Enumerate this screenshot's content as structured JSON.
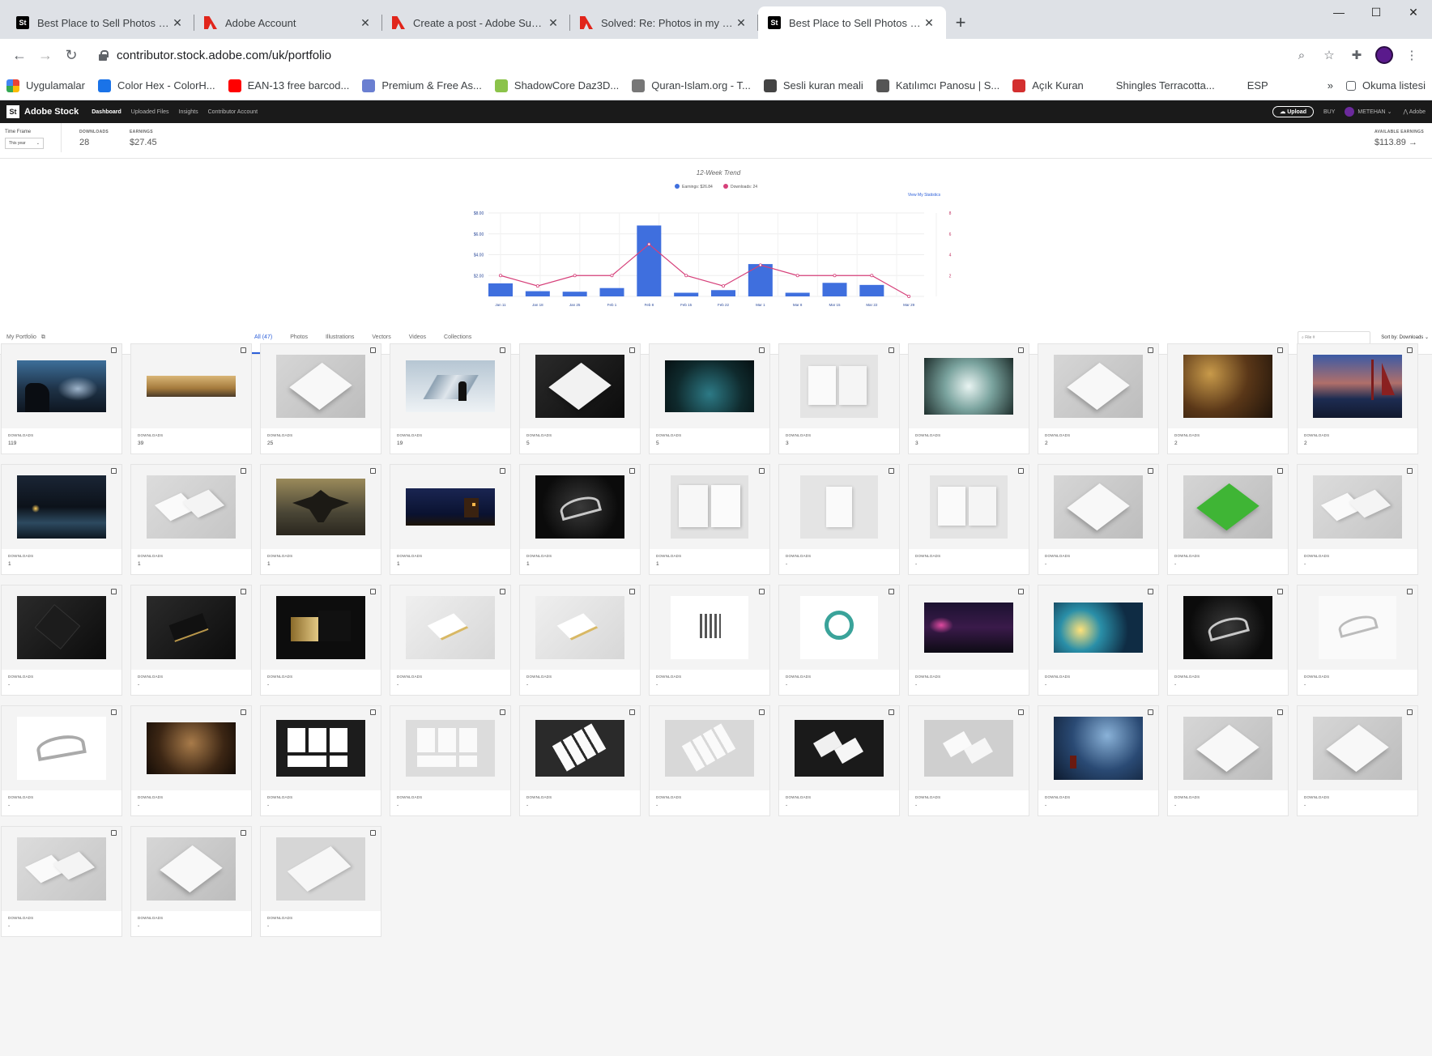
{
  "browser": {
    "tabs": [
      {
        "title": "Best Place to Sell Photos Online,",
        "icon": "adobe-stock-icon",
        "active": false
      },
      {
        "title": "Adobe Account",
        "icon": "adobe-icon",
        "active": false
      },
      {
        "title": "Create a post - Adobe Support C",
        "icon": "adobe-icon",
        "active": false
      },
      {
        "title": "Solved: Re: Photos in my portfoli",
        "icon": "adobe-icon",
        "active": false
      },
      {
        "title": "Best Place to Sell Photos Online,",
        "icon": "adobe-stock-icon",
        "active": true
      }
    ],
    "url": "contributor.stock.adobe.com/uk/portfolio",
    "bookmarks": [
      "Uygulamalar",
      "Color Hex - ColorH...",
      "EAN-13 free barcod...",
      "Premium & Free As...",
      "ShadowCore Daz3D...",
      "Quran-Islam.org - T...",
      "Sesli kuran meali",
      "Katılımcı Panosu | S...",
      "Açık Kuran",
      "Shingles Terracotta...",
      "ESP"
    ],
    "reading_list": "Okuma listesi",
    "overflow": "»"
  },
  "stock": {
    "logo": "St",
    "brand": "Adobe Stock",
    "nav": [
      "Dashboard",
      "Uploaded Files",
      "Insights",
      "Contributor Account"
    ],
    "upload": "Upload",
    "buy": "BUY",
    "user": "METEHAN",
    "adobe": "Adobe"
  },
  "summary": {
    "timeframe_label": "Time Frame",
    "timeframe_value": "This year",
    "downloads_label": "DOWNLOADS",
    "downloads": "28",
    "earnings_label": "EARNINGS",
    "earnings": "$27.45",
    "available_label": "AVAILABLE EARNINGS",
    "available": "$113.89 →"
  },
  "chart_data": {
    "type": "bar",
    "title": "12-Week Trend",
    "legend": [
      "Earnings: $26.84",
      "Downloads: 24"
    ],
    "link": "View My Statistics",
    "categories": [
      "Jan 11",
      "Jan 18",
      "Jan 25",
      "Feb 1",
      "Feb 8",
      "Feb 15",
      "Feb 22",
      "Mar 1",
      "Mar 8",
      "Mar 15",
      "Mar 22",
      "Mar 29"
    ],
    "series": [
      {
        "name": "Earnings: $26.84",
        "type": "bar",
        "axis": "left",
        "values": [
          1.25,
          0.5,
          0.45,
          0.8,
          6.8,
          0.35,
          0.6,
          3.1,
          0.35,
          1.3,
          1.1,
          0.0
        ]
      },
      {
        "name": "Downloads: 24",
        "type": "line",
        "axis": "right",
        "values": [
          2,
          1,
          2,
          2,
          5,
          2,
          1,
          3,
          2,
          2,
          2,
          0
        ]
      }
    ],
    "ylim_left": [
      0,
      8
    ],
    "yticks_left": [
      "$2.00",
      "$4.00",
      "$6.00",
      "$8.00"
    ],
    "ylim_right": [
      0,
      8
    ],
    "yticks_right": [
      "2",
      "4",
      "6",
      "8"
    ],
    "colors": {
      "bar": "#3f6fde",
      "line": "#d6407a"
    }
  },
  "portfolio": {
    "title": "My Portfolio",
    "tabs": [
      "All (47)",
      "Photos",
      "Illustrations",
      "Vectors",
      "Videos",
      "Collections"
    ],
    "search_placeholder": "File #",
    "sort": "Sort by: Downloads",
    "downloads_label": "DOWNLOADS",
    "items": [
      {
        "type": "fantasy-dark",
        "dl": "119"
      },
      {
        "type": "panorama",
        "dl": "39"
      },
      {
        "type": "paper-gray",
        "dl": "25"
      },
      {
        "type": "snow-wolf",
        "dl": "19"
      },
      {
        "type": "paper-dark",
        "dl": "5"
      },
      {
        "type": "forest",
        "dl": "5"
      },
      {
        "type": "book-open",
        "dl": "3"
      },
      {
        "type": "ice-wave",
        "dl": "3"
      },
      {
        "type": "paper-gray",
        "dl": "2"
      },
      {
        "type": "tavern",
        "dl": "2"
      },
      {
        "type": "ships",
        "dl": "2"
      },
      {
        "type": "cave-river",
        "dl": "1"
      },
      {
        "type": "two-cards",
        "dl": "1"
      },
      {
        "type": "dragon",
        "dl": "1"
      },
      {
        "type": "night-town",
        "dl": "1"
      },
      {
        "type": "heels-dark",
        "dl": "1"
      },
      {
        "type": "book-cover",
        "dl": "1"
      },
      {
        "type": "single-page",
        "dl": "-"
      },
      {
        "type": "book-open",
        "dl": "-"
      },
      {
        "type": "paper-gray",
        "dl": "-"
      },
      {
        "type": "green-paper",
        "dl": "-"
      },
      {
        "type": "two-cards",
        "dl": "-"
      },
      {
        "type": "dark-stationery",
        "dl": "-"
      },
      {
        "type": "black-gold-cards",
        "dl": "-"
      },
      {
        "type": "black-gold-cards2",
        "dl": "-"
      },
      {
        "type": "gold-cards",
        "dl": "-"
      },
      {
        "type": "gold-cards",
        "dl": "-"
      },
      {
        "type": "logo-lines",
        "dl": "-"
      },
      {
        "type": "logo-wreath",
        "dl": "-"
      },
      {
        "type": "neon-city",
        "dl": "-"
      },
      {
        "type": "fire-dragon",
        "dl": "-"
      },
      {
        "type": "heels-dark",
        "dl": "-"
      },
      {
        "type": "heel-white",
        "dl": "-"
      },
      {
        "type": "heels-white",
        "dl": "-"
      },
      {
        "type": "hall",
        "dl": "-"
      },
      {
        "type": "stationery-dark",
        "dl": "-"
      },
      {
        "type": "stationery-light",
        "dl": "-"
      },
      {
        "type": "cards-dark",
        "dl": "-"
      },
      {
        "type": "cards-light",
        "dl": "-"
      },
      {
        "type": "biz-dark",
        "dl": "-"
      },
      {
        "type": "biz-gray",
        "dl": "-"
      },
      {
        "type": "blue-ruins",
        "dl": "-"
      },
      {
        "type": "paper-gray",
        "dl": "-"
      },
      {
        "type": "paper-gray",
        "dl": "-"
      },
      {
        "type": "two-cards",
        "dl": "-"
      },
      {
        "type": "paper-gray",
        "dl": "-"
      },
      {
        "type": "book-open-angled",
        "dl": "-"
      }
    ]
  },
  "colors": {
    "accent": "#2c5fd9",
    "header_bg": "#1a1a1a",
    "tabbar_bg": "#dee1e6"
  }
}
